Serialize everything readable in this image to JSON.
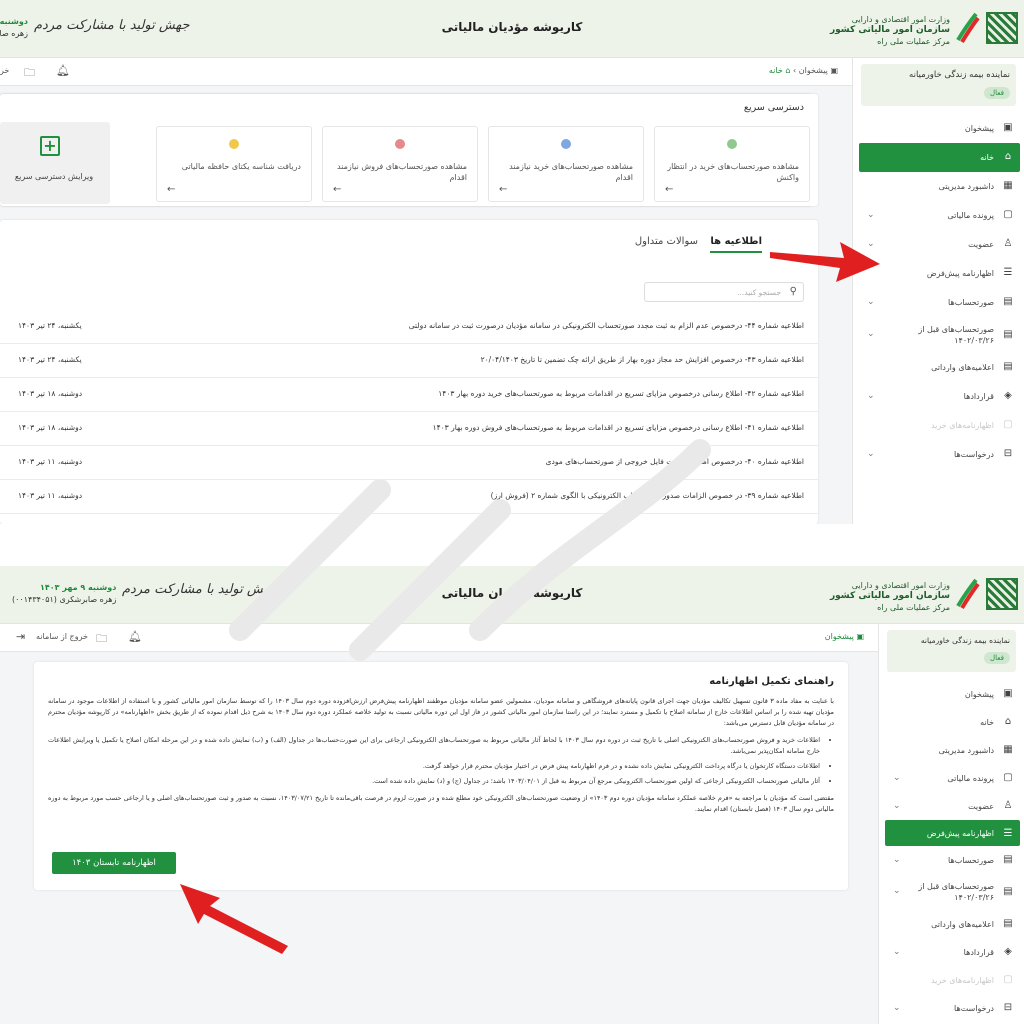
{
  "header": {
    "app_title": "کاریوشه مؤدیان مالیاتی",
    "slogan": "جهش تولید با مشارکت مردم",
    "logo_lines": [
      "وزارت امور اقتصادی و دارایی",
      "سازمان امور مالیاتی کشور",
      "مرکز عملیات ملی راه"
    ]
  },
  "shot1": {
    "user_date": "دوشنبه",
    "user_name": "زهره صابر"
  },
  "shot2": {
    "user_date": "دوشنبه ۹ مهر ۱۴۰۳",
    "user_name": "زهره صابرشکری (۰۰۱۴۳۴۰۵۱)",
    "logout_label": "خروج از سامانه"
  },
  "toolbar1": {
    "logout_label": "خر"
  },
  "breadcrumb": {
    "desk": "پیشخوان",
    "home": "خانه",
    "sep": "›"
  },
  "sidebar": {
    "rep_name": "نماینده بیمه زندگی خاورمیانه",
    "rep_status": "فعال",
    "items": [
      {
        "label": "پیشخوان",
        "icon": "▣"
      },
      {
        "label": "خانه",
        "icon": "⌂"
      },
      {
        "label": "داشبورد مدیریتی",
        "icon": "▦"
      },
      {
        "label": "پرونده مالیاتی",
        "icon": "▢"
      },
      {
        "label": "عضویت",
        "icon": "♙"
      },
      {
        "label": "اظهارنامه پیش‌فرض",
        "icon": "☰"
      },
      {
        "label": "صورتحساب‌ها",
        "icon": "▤"
      },
      {
        "label": "صورتحساب‌های قبل از ۱۴۰۲/۰۳/۲۶",
        "icon": "▤"
      },
      {
        "label": "اعلامیه‌های وارداتی",
        "icon": "▤"
      },
      {
        "label": "قراردادها",
        "icon": "◈"
      },
      {
        "label": "اظهارنامه‌های خرید",
        "icon": "▢"
      },
      {
        "label": "درخواست‌ها",
        "icon": "⊟"
      }
    ]
  },
  "quick_access": {
    "title": "دسترسی سریع",
    "tiles": [
      {
        "label": "مشاهده صورتحساب‌های خرید در انتظار واکنش",
        "color": "#8fc98f"
      },
      {
        "label": "مشاهده صورتحساب‌های خرید نیازمند اقدام",
        "color": "#7fa8e0"
      },
      {
        "label": "مشاهده صورتحساب‌های فروش نیازمند اقدام",
        "color": "#e58a8a"
      },
      {
        "label": "دریافت شناسه یکتای حافظه مالیاتی",
        "color": "#f0c84a"
      }
    ],
    "edit_label": "ویرایش دسترسی سریع",
    "arrow": "←"
  },
  "tabs": {
    "announcements": "اطلاعیه ها",
    "faq": "سوالات متداول"
  },
  "search": {
    "placeholder": "جستجو کنید..."
  },
  "announcements": [
    {
      "title": "اطلاعیه شماره ۴۴- درخصوص عدم الزام به ثبت مجدد صورتحساب الکترونیکی در سامانه مؤدیان درصورت ثبت در سامانه دولتی",
      "date": "یکشنبه، ۲۴ تیر ۱۴۰۳"
    },
    {
      "title": "اطلاعیه شماره ۴۳- درخصوص افزایش حد مجاز دوره بهار از طریق ارائه چک تضمین تا تاریخ ۲۰/۰۴/۱۴۰۳",
      "date": "یکشنبه، ۲۴ تیر ۱۴۰۳"
    },
    {
      "title": "اطلاعیه شماره ۴۲- اطلاع رسانی درخصوص مزایای تسریع در اقدامات مربوط به صورتحساب‌های خرید دوره بهار ۱۴۰۳",
      "date": "دوشنبه، ۱۸ تیر ۱۴۰۳"
    },
    {
      "title": "اطلاعیه شماره ۴۱- اطلاع رسانی درخصوص مزایای تسریع در اقدامات مربوط به صورتحساب‌های فروش دوره بهار ۱۴۰۳",
      "date": "دوشنبه، ۱۸ تیر ۱۴۰۳"
    },
    {
      "title": "اطلاعیه شماره ۴۰- درخصوص امکان دریافت فایل خروجی از صورتحساب‌های مودی",
      "date": "دوشنبه، ۱۱ تیر ۱۴۰۳"
    },
    {
      "title": "اطلاعیه شماره ۳۹- در خصوص الزامات صدور صورتحساب الکترونیکی با الگوی شماره ۲ (فروش ارز)",
      "date": "دوشنبه، ۱۱ تیر ۱۴۰۳"
    }
  ],
  "guide": {
    "title": "راهنمای تکمیل اظهارنامه",
    "intro": "با عنایت به مفاد ماده ۳ قانون تسهیل تکالیف مؤدیان جهت اجرای قانون پایانه‌های فروشگاهی و سامانه مودیان، مشمولین عضو سامانه مؤدیان موظفند اظهارنامه پیش‌فرض ارزش‌افزوده دوره دوم سال ۱۴۰۳ را که توسط سازمان امور مالیاتی کشور و با استفاده از اطلاعات موجود در سامانه مؤدیان تهیه شده را بر اساس اطلاعات خارج از سامانه اصلاح یا تکمیل و مسترد نمایند؛ در این راستا سازمان امور مالیاتی کشور در فاز اول این دوره مالیاتی نسبت به تولید خلاصه عملکرد دوره دوم سال ۱۴۰۳ به شرح ذیل اقدام نموده که از طریق بخش «اظهارنامه» در کارپوشه مؤدیان محترم در سامانه مؤدیان قابل دسترس می‌باشد:",
    "bullets": [
      "اطلاعات خرید و فروش صورتحساب‌های الکترونیکی اصلی با تاریخ ثبت در دوره دوم سال ۱۴۰۳ با لحاظ آثار مالیاتی مربوط به صورتحساب‌های الکترونیکی ارجاعی برای این صورت‌حساب‌ها در جداول (الف) و (ب) نمایش داده شده و در این مرحله امکان اصلاح یا تکمیل یا ویرایش اطلاعات خارج سامانه امکان‌پذیر نمی‌باشد.",
      "اطلاعات دستگاه کارتخوان یا درگاه پرداخت الکترونیکی نمایش داده نشده و در فرم اظهارنامه پیش فرض در اختیار مؤدیان محترم قرار خواهد گرفت.",
      "آثار مالیاتی صورتحساب الکترونیکی ارجاعی که اولین صورتحساب الکترونیکی مرجع آن مربوط به قبل از ۱۴۰۳/۰۴/۰۱ باشد؛ در جداول (ج) و (د) نمایش داده شده است."
    ],
    "closing": "مقتضی است که مؤدیان با مراجعه به «فرم خلاصه عملکرد سامانه مؤدیان دوره دوم ۱۴۰۳» از وضعیت صورتحساب‌های الکترونیکی خود مطلع شده و در صورت لزوم در فرصت باقی‌مانده تا تاریخ ۱۴۰۳/۰۷/۲۱، نسبت به صدور و ثبت صورتحساب‌های اصلی و یا ارجاعی حسب مورد مربوط به دوره مالیاتی دوم سال ۱۴۰۳ (فصل تابستان) اقدام نمایند.",
    "button": "اظهارنامه تابستان ۱۴۰۳"
  },
  "colors": {
    "brand_green": "#21913f",
    "header_bg": "#eef3ea",
    "arrow_red": "#e02020"
  }
}
